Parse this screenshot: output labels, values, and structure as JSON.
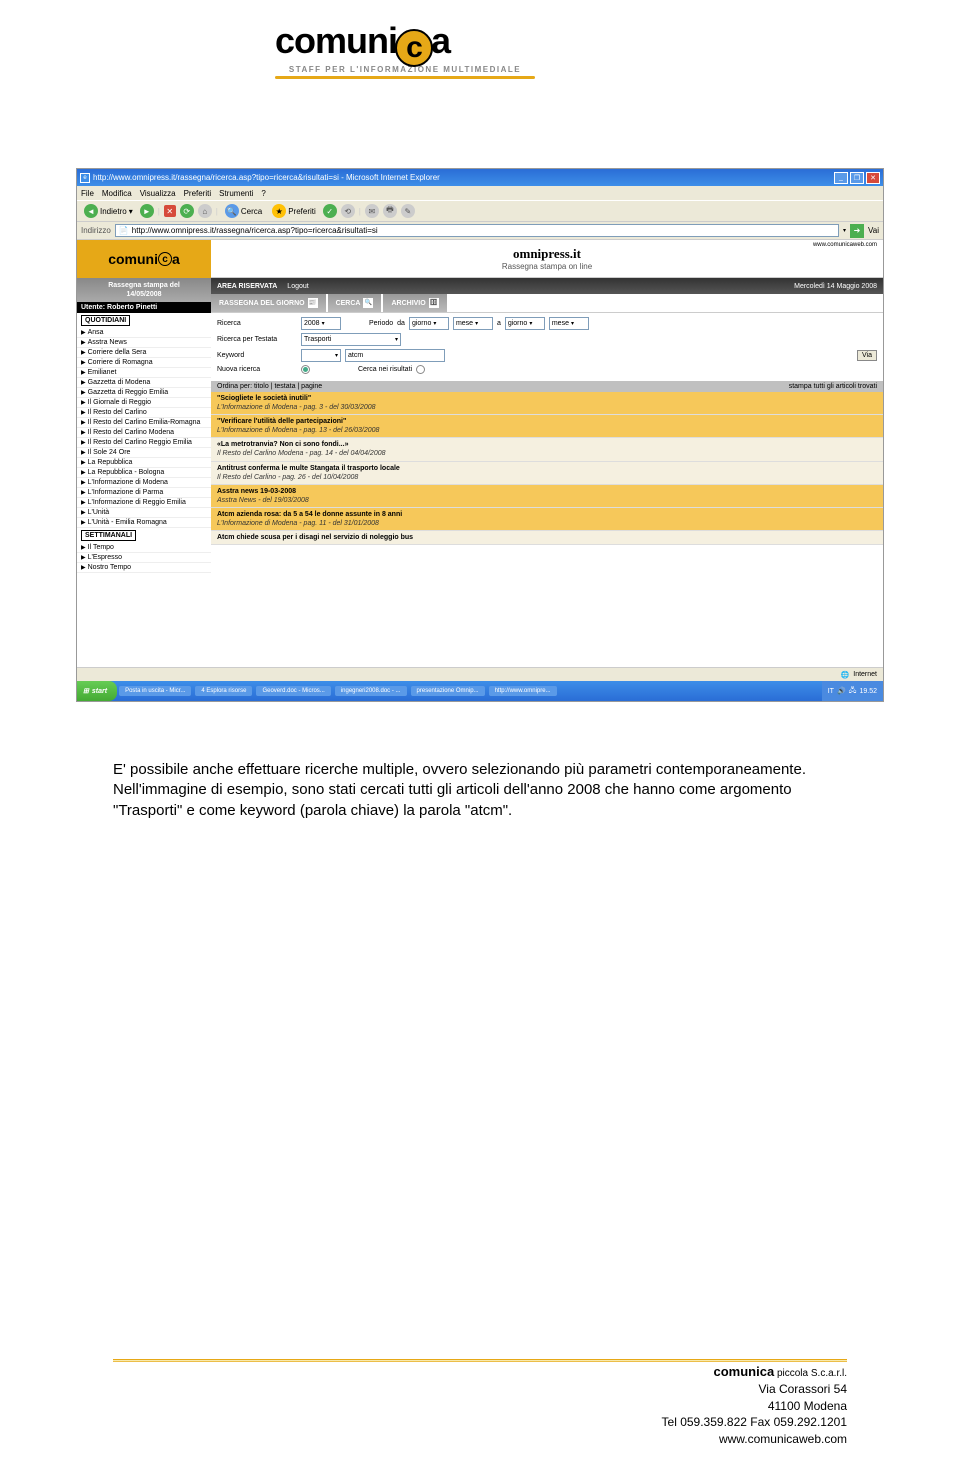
{
  "logo": {
    "brand_left": "comuni",
    "brand_c": "c",
    "brand_right": "a",
    "tagline": "STAFF PER L'INFORMAZIONE MULTIMEDIALE"
  },
  "browser": {
    "title": "http://www.omnipress.it/rassegna/ricerca.asp?tipo=ricerca&risultati=si - Microsoft Internet Explorer",
    "menu": {
      "file": "File",
      "modifica": "Modifica",
      "visualizza": "Visualizza",
      "preferiti": "Preferiti",
      "strumenti": "Strumenti",
      "help": "?"
    },
    "toolbar": {
      "indietro": "Indietro",
      "cerca": "Cerca",
      "preferiti": "Preferiti"
    },
    "address_label": "Indirizzo",
    "address_value": "http://www.omnipress.it/rassegna/ricerca.asp?tipo=ricerca&risultati=si",
    "go": "Vai",
    "status": "Internet"
  },
  "site": {
    "sidebar_logo": "comunica",
    "rassegna_label": "Rassegna stampa del",
    "rassegna_date": "14/05/2008",
    "user_label": "Utente: Roberto Pinetti",
    "cat_quotidiani": "QUOTIDIANI",
    "cat_settimanali": "SETTIMANALI",
    "quotidiani": [
      "Ansa",
      "Asstra News",
      "Corriere della Sera",
      "Corriere di Romagna",
      "Emilianet",
      "Gazzetta di Modena",
      "Gazzetta di Reggio Emilia",
      "Il Giornale di Reggio",
      "Il Resto del Carlino",
      "Il Resto del Carlino Emilia-Romagna",
      "Il Resto del Carlino Modena",
      "Il Resto del Carlino Reggio Emilia",
      "Il Sole 24 Ore",
      "La Repubblica",
      "La Repubblica - Bologna",
      "L'Informazione di Modena",
      "L'Informazione di Parma",
      "L'Informazione di Reggio Emilia",
      "L'Unità",
      "L'Unità - Emilia Romagna"
    ],
    "settimanali": [
      "Il Tempo",
      "L'Espresso",
      "Nostro Tempo"
    ],
    "header": {
      "url": "www.comunicaweb.com",
      "brand": "omnipress.it",
      "tagline": "Rassegna stampa on line",
      "area": "AREA RISERVATA",
      "logout": "Logout",
      "date": "Mercoledì 14 Maggio 2008"
    },
    "tabs": {
      "rassegna": "RASSEGNA DEL GIORNO",
      "cerca": "CERCA",
      "archivio": "ARCHIVIO"
    },
    "form": {
      "ricerca": "Ricerca",
      "anno": "2008",
      "periodo": "Periodo",
      "da": "da",
      "a": "a",
      "giorno": "giorno",
      "mese": "mese",
      "testata_label": "Ricerca per Testata",
      "testata_value": "Trasporti",
      "keyword_label": "Keyword",
      "keyword_value": "atcm",
      "via": "Via",
      "nuova": "Nuova ricerca",
      "nei": "Cerca nei risultati"
    },
    "results_header": {
      "ordina": "Ordina per: titolo | testata | pagine",
      "stampa": "stampa tutti gli articoli trovati"
    },
    "results": [
      {
        "title": "\"Sciogliete le società inutili\"",
        "meta": "L'Informazione di Modena - pag. 3 - del 30/03/2008"
      },
      {
        "title": "\"Verificare l'utilità delle partecipazioni\"",
        "meta": "L'Informazione di Modena - pag. 13 - del 26/03/2008"
      },
      {
        "title": "«La metrotranvia? Non ci sono fondi...»",
        "meta": "Il Resto del Carlino Modena - pag. 14 - del 04/04/2008"
      },
      {
        "title": "Antitrust conferma le multe Stangata il trasporto locale",
        "meta": "Il Resto del Carlino - pag. 26 - del 10/04/2008"
      },
      {
        "title": "Asstra news 19-03-2008",
        "meta": "Asstra News - del 19/03/2008"
      },
      {
        "title": "Atcm azienda rosa: da 5 a 54 le donne assunte in 8 anni",
        "meta": "L'Informazione di Modena - pag. 11 - del 31/01/2008"
      },
      {
        "title": "Atcm chiede scusa per i disagi nel servizio di noleggio bus",
        "meta": ""
      }
    ]
  },
  "taskbar": {
    "start": "start",
    "items": [
      "Posta in uscita - Micr...",
      "4 Esplora risorse",
      "Geoverd.doc - Micros...",
      "ingegneri2008.doc - ...",
      "presentazione Omnip...",
      "http://www.omnipre..."
    ],
    "lang": "IT",
    "time": "19.52"
  },
  "paragraph": {
    "line1": "E' possibile anche effettuare ricerche multiple, ovvero selezionando più parametri contemporaneamente.",
    "line2": "Nell'immagine di esempio, sono stati cercati tutti gli articoli dell'anno 2008 che hanno come argomento \"Trasporti\" e come keyword (parola chiave) la parola \"atcm\"."
  },
  "footer": {
    "company_b": "comunica",
    "company_s": " piccola S.c.a.r.l.",
    "addr1": "Via Corassori 54",
    "addr2": "41100 Modena",
    "tel": "Tel 059.359.822 Fax 059.292.1201",
    "web": "www.comunicaweb.com"
  }
}
